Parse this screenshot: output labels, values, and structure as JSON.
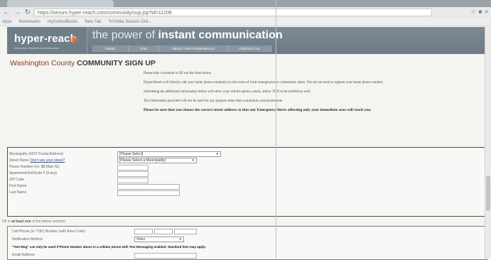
{
  "browser": {
    "url_prefix": "https://",
    "url_rest": "secure.hyper-reach.com/community/sup.jsp?id=11206",
    "bookmarks": [
      "Apps",
      "Bookmarks",
      "mySchoolBucks",
      "New Tab",
      "YoYoMa Season Ord..."
    ]
  },
  "banner": {
    "logo": "hyper-reach",
    "logo_tag": "the power of instant communication",
    "tagline_prefix": "the power of ",
    "tagline_bold": "instant communication",
    "menu": [
      "HOME",
      "FAQ",
      "ABOUT THE HYPER-REACH",
      "CONTACT US"
    ]
  },
  "page": {
    "county": "Washington County",
    "title": "COMMUNITY SIGN UP"
  },
  "intro": {
    "p1": "Please take a moment to fill out the form below.",
    "p2": "Hyper-Reach will directly call your home phone number(s) in the event of local emergencies or community alerts. You do not need to register your home phone number.",
    "p3": "Submitting the additional information below will allow your cellular phone, email, and/or TDD to be notified as well.",
    "p4": "The information provided will not be used for any purpose other than community announcements.",
    "p5": "Please be sure that you choose the correct street address so that any Emergency Alerts affecting only your immediate area will reach you."
  },
  "form": {
    "municipality_label": "Municipality (NOT Postal Address)",
    "municipality_value": "[Please Select]",
    "street_label": "Street Name",
    "street_link": "Don't see your street?",
    "street_value": "[Please Select a Municipality]",
    "house_label": "House Number (ex: ",
    "house_example": "33",
    "house_label_end": " Main St)",
    "apt_label": "Apartment/Unit/Suite # (if any)",
    "zip_label": "ZIP Code",
    "first_label": "First Name",
    "last_label": "Last Name"
  },
  "section2": {
    "intro_prefix": "Fill in ",
    "intro_bold": "at least one",
    "intro_suffix": " of the below sections:",
    "cell_label": "Cell Phone (or TDD) Number (with Area Code)",
    "method_label": "Notification Method",
    "method_value": "Voice",
    "text_prefix": "\"Text Msg\" can only be used if Phone Number above is a cellular phone with Text Messaging enabled. Standard fees may apply.",
    "email_label": "Email Address"
  }
}
